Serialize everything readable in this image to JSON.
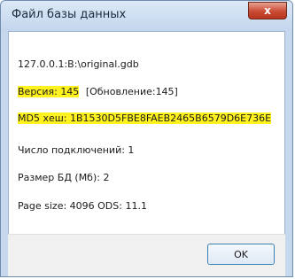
{
  "window": {
    "title": "Файл базы данных",
    "close_symbol": "x"
  },
  "info": {
    "path": "127.0.0.1:B:\\original.gdb",
    "version_label": "Версия: 145",
    "update_label": "[Обновление:145]",
    "md5_label": "MD5 хеш: 1B1530D5FBE8FAEB2465B6579D6E736E",
    "connections": "Число подключений: 1",
    "db_size": "Размер БД (Мб): 2",
    "page_size": "Page size: 4096 ODS: 11.1"
  },
  "buttons": {
    "ok_label": "OK"
  },
  "colors": {
    "highlight": "#fff21e",
    "close_button": "#c84b34",
    "titlebar": "#c6d8ee"
  }
}
